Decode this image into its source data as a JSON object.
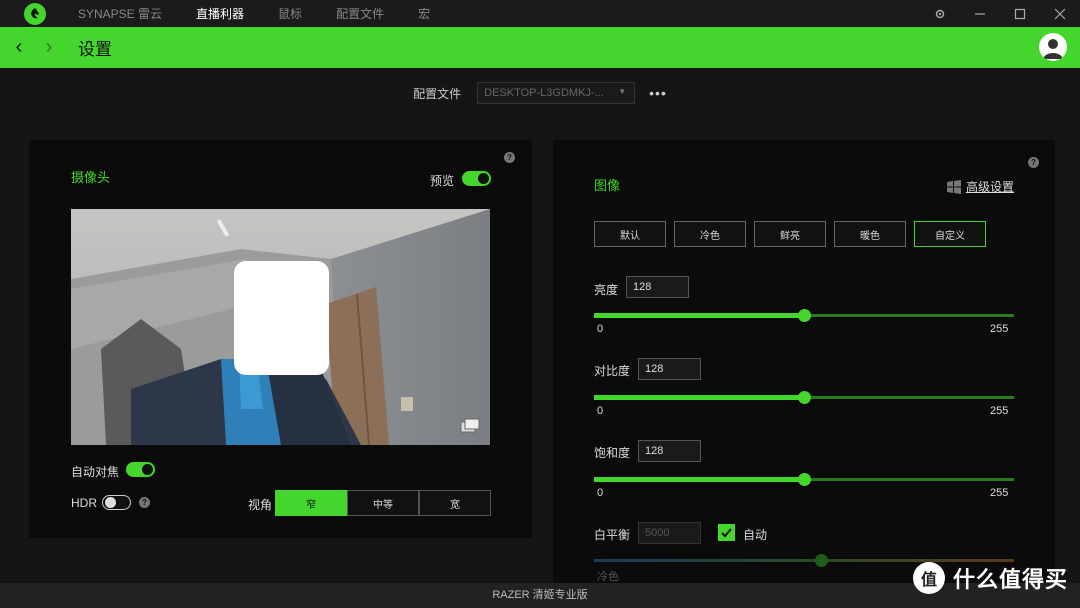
{
  "titlebar": {
    "nav": [
      "SYNAPSE 雷云",
      "直播利器",
      "鼠标",
      "配置文件",
      "宏"
    ],
    "active_index": 1
  },
  "header": {
    "title": "设置"
  },
  "profile": {
    "label": "配置文件",
    "value": "DESKTOP-L3GDMKJ-...",
    "more": "•••"
  },
  "camera_panel": {
    "title": "摄像头",
    "preview_label": "预览",
    "preview_on": true,
    "autofocus_label": "自动对焦",
    "autofocus_on": true,
    "hdr_label": "HDR",
    "hdr_on": false,
    "fov_label": "视角",
    "fov_options": [
      "窄",
      "中等",
      "宽"
    ],
    "fov_selected": 0
  },
  "image_panel": {
    "title": "图像",
    "advanced_label": "高级设置",
    "presets": [
      "默认",
      "冷色",
      "鲜亮",
      "暖色",
      "自定义"
    ],
    "preset_selected": 4,
    "sliders": [
      {
        "label": "亮度",
        "value": "128",
        "min": "0",
        "max": "255",
        "level": 0.5
      },
      {
        "label": "对比度",
        "value": "128",
        "min": "0",
        "max": "255",
        "level": 0.5
      },
      {
        "label": "饱和度",
        "value": "128",
        "min": "0",
        "max": "255",
        "level": 0.5
      }
    ],
    "white_balance": {
      "label": "白平衡",
      "value": "5000",
      "auto_label": "自动",
      "auto_checked": true,
      "min_label": "冷色",
      "level": 0.54
    }
  },
  "footer": {
    "text": "RAZER 清姬专业版"
  },
  "watermark": {
    "glyph": "值",
    "text": "什么值得买"
  },
  "colors": {
    "accent": "#44d62c",
    "background": "#151515",
    "panel": "#0b0b0b"
  }
}
